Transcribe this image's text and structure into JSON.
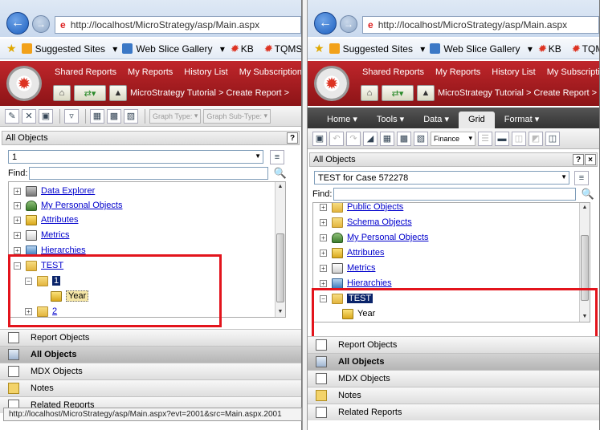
{
  "browser": {
    "url": "http://localhost/MicroStrategy/asp/Main.aspx",
    "url_host": "localhost",
    "favorites": [
      "Suggested Sites",
      "Web Slice Gallery",
      "KB",
      "TQMS"
    ]
  },
  "header": {
    "nav": [
      "Shared Reports",
      "My Reports",
      "History List",
      "My Subscriptions"
    ],
    "breadcrumb": "MicroStrategy Tutorial > Create Report >"
  },
  "left": {
    "toolbar": {
      "graph_type": "Graph Type:",
      "graph_subtype": "Graph Sub-Type:"
    },
    "panel_title": "All Objects",
    "help": "?",
    "selector_value": "1",
    "find_label": "Find:",
    "tree": [
      {
        "label": "Data Explorer",
        "icon": "db-icon"
      },
      {
        "label": "My Personal Objects",
        "icon": "person-icon"
      },
      {
        "label": "Attributes",
        "icon": "attribute-icon"
      },
      {
        "label": "Metrics",
        "icon": "metric-icon"
      },
      {
        "label": "Hierarchies",
        "icon": "hierarchy-icon"
      },
      {
        "label": "TEST",
        "icon": "folder-icon"
      },
      {
        "label": "1",
        "icon": "folder-icon"
      },
      {
        "label": "Year",
        "icon": "attribute-icon"
      },
      {
        "label": "2",
        "icon": "folder-icon"
      }
    ],
    "accordion": [
      "Report Objects",
      "All Objects",
      "MDX Objects",
      "Notes",
      "Related Reports"
    ],
    "status": "http://localhost/MicroStrategy/asp/Main.aspx?evt=2001&src=Main.aspx.2001"
  },
  "right": {
    "tabs": [
      "Home",
      "Tools",
      "Data",
      "Grid",
      "Format"
    ],
    "active_tab": "Grid",
    "style_select": "Finance",
    "panel_title": "All Objects",
    "help": "?",
    "close": "×",
    "selector_value": "TEST for Case 572278",
    "find_label": "Find:",
    "tree": [
      {
        "label": "Public Objects",
        "icon": "folder-icon"
      },
      {
        "label": "Schema Objects",
        "icon": "folder-icon"
      },
      {
        "label": "My Personal Objects",
        "icon": "person-icon"
      },
      {
        "label": "Attributes",
        "icon": "attribute-icon"
      },
      {
        "label": "Metrics",
        "icon": "metric-icon"
      },
      {
        "label": "Hierarchies",
        "icon": "hierarchy-icon"
      },
      {
        "label": "TEST",
        "icon": "folder-icon"
      },
      {
        "label": "Year",
        "icon": "attribute-icon"
      }
    ],
    "accordion": [
      "Report Objects",
      "All Objects",
      "MDX Objects",
      "Notes",
      "Related Reports"
    ]
  },
  "colors": {
    "highlight_box": "#e3141c",
    "header_red": "#b01e22",
    "link_blue": "#0000cc",
    "selection_navy": "#0a246a"
  }
}
